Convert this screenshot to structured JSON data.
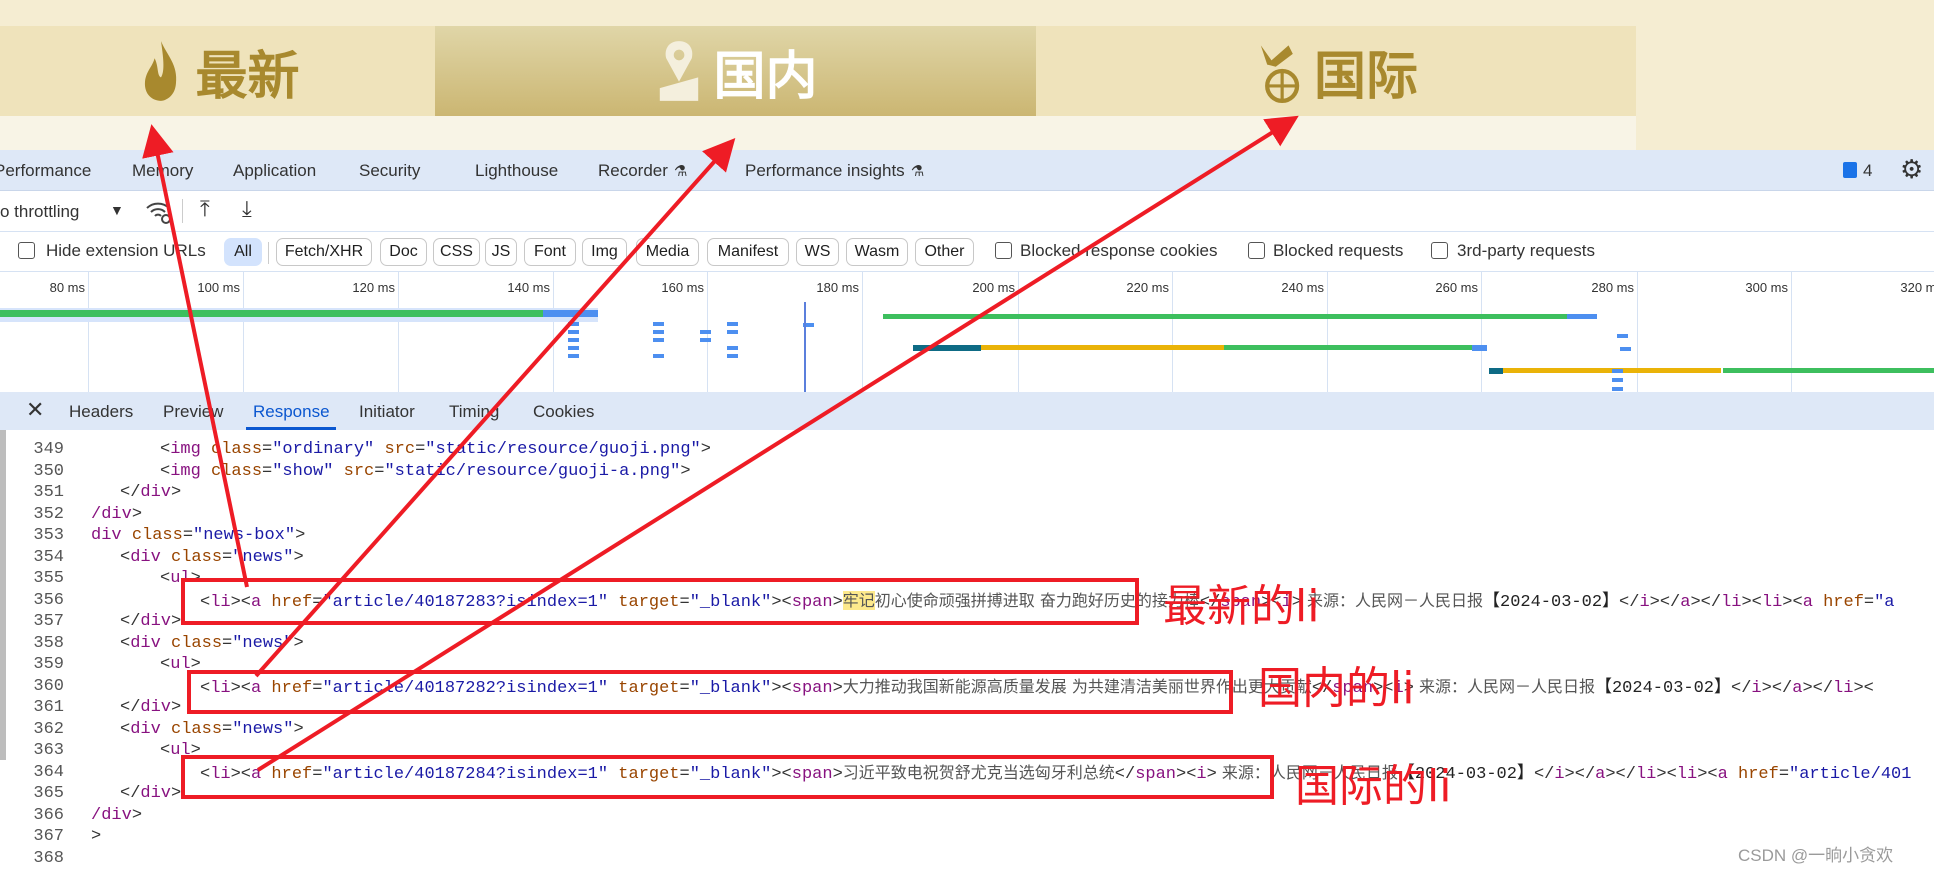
{
  "banner": {
    "tabs": [
      {
        "label": "最新",
        "icon": "flame-icon",
        "active": false
      },
      {
        "label": "国内",
        "icon": "map-pin-icon",
        "active": true
      },
      {
        "label": "国际",
        "icon": "globe-plane-icon",
        "active": false
      }
    ],
    "colors": {
      "tab_bg": "#efe3bb",
      "active_top": "#e0d6a8",
      "active_bottom": "#cbb672",
      "text": "#a8892e"
    }
  },
  "devtools": {
    "tabs": [
      "Performance",
      "Memory",
      "Application",
      "Security",
      "Lighthouse",
      "Recorder",
      "Performance insights"
    ],
    "issues_count": "4",
    "throttling": "o throttling",
    "filters": {
      "hide_ext": "Hide extension URLs",
      "chips": [
        "All",
        "Fetch/XHR",
        "Doc",
        "CSS",
        "JS",
        "Font",
        "Img",
        "Media",
        "Manifest",
        "WS",
        "Wasm",
        "Other"
      ],
      "checks": [
        "Blocked response cookies",
        "Blocked requests",
        "3rd-party requests"
      ]
    },
    "timeline_ticks": [
      "80 ms",
      "100 ms",
      "120 ms",
      "140 ms",
      "160 ms",
      "180 ms",
      "200 ms",
      "220 ms",
      "240 ms",
      "260 ms",
      "280 ms",
      "300 ms",
      "320 ms"
    ],
    "detail_tabs": [
      "Headers",
      "Preview",
      "Response",
      "Initiator",
      "Timing",
      "Cookies"
    ],
    "selected_detail_tab": "Response"
  },
  "code": [
    {
      "n": "349",
      "i": 2,
      "t": [
        [
          "br",
          "<"
        ],
        [
          "tag",
          "img"
        ],
        [
          "br",
          " "
        ],
        [
          "attr",
          "class"
        ],
        [
          "br",
          "="
        ],
        [
          "val",
          "\"ordinary\""
        ],
        [
          "br",
          " "
        ],
        [
          "attr",
          "src"
        ],
        [
          "br",
          "="
        ],
        [
          "val",
          "\"static/resource/guoji.png\""
        ],
        [
          "br",
          ">"
        ]
      ]
    },
    {
      "n": "350",
      "i": 2,
      "t": [
        [
          "br",
          "<"
        ],
        [
          "tag",
          "img"
        ],
        [
          "br",
          " "
        ],
        [
          "attr",
          "class"
        ],
        [
          "br",
          "="
        ],
        [
          "val",
          "\"show\""
        ],
        [
          "br",
          " "
        ],
        [
          "attr",
          "src"
        ],
        [
          "br",
          "="
        ],
        [
          "val",
          "\"static/resource/guoji-a.png\""
        ],
        [
          "br",
          ">"
        ]
      ]
    },
    {
      "n": "351",
      "i": 1,
      "t": [
        [
          "br",
          "</"
        ],
        [
          "tag",
          "div"
        ],
        [
          "br",
          ">"
        ]
      ]
    },
    {
      "n": "352",
      "i": 0,
      "t": [
        [
          "tag",
          "/div"
        ],
        [
          "br",
          ">"
        ]
      ]
    },
    {
      "n": "353",
      "i": 0,
      "t": [
        [
          "tag",
          "div"
        ],
        [
          "br",
          " "
        ],
        [
          "attr",
          "class"
        ],
        [
          "br",
          "="
        ],
        [
          "val",
          "\"news-box\""
        ],
        [
          "br",
          ">"
        ]
      ]
    },
    {
      "n": "354",
      "i": 1,
      "t": [
        [
          "br",
          "<"
        ],
        [
          "tag",
          "div"
        ],
        [
          "br",
          " "
        ],
        [
          "attr",
          "class"
        ],
        [
          "br",
          "="
        ],
        [
          "val",
          "\"news\""
        ],
        [
          "br",
          ">"
        ]
      ]
    },
    {
      "n": "355",
      "i": 2,
      "t": [
        [
          "br",
          "<"
        ],
        [
          "tag",
          "ul"
        ],
        [
          "br",
          ">"
        ]
      ]
    },
    {
      "n": "356",
      "i": 3,
      "t": [
        [
          "br",
          "<"
        ],
        [
          "tag",
          "li"
        ],
        [
          "br",
          "><"
        ],
        [
          "tag",
          "a"
        ],
        [
          "br",
          " "
        ],
        [
          "attr",
          "href"
        ],
        [
          "br",
          "="
        ],
        [
          "val",
          "\"article/40187283?isindex=1\""
        ],
        [
          "br",
          " "
        ],
        [
          "attr",
          "target"
        ],
        [
          "br",
          "="
        ],
        [
          "val",
          "\"_blank\""
        ],
        [
          "br",
          "><"
        ],
        [
          "tag",
          "span"
        ],
        [
          "br",
          ">"
        ],
        [
          "hl",
          "牢记"
        ],
        [
          "txt",
          "初心使命顽强拼搏进取 奋力跑好历史的接力棒"
        ],
        [
          "br",
          "</"
        ],
        [
          "tag",
          "span"
        ],
        [
          "br",
          "><"
        ],
        [
          "tag",
          "i"
        ],
        [
          "br",
          ">"
        ],
        [
          "txt",
          " 来源：人民网－人民日报"
        ],
        [
          "dark",
          "【2024-03-02】"
        ],
        [
          "br",
          "</"
        ],
        [
          "tag",
          "i"
        ],
        [
          "br",
          "></"
        ],
        [
          "tag",
          "a"
        ],
        [
          "br",
          "></"
        ],
        [
          "tag",
          "li"
        ],
        [
          "br",
          "><"
        ],
        [
          "tag",
          "li"
        ],
        [
          "br",
          "><"
        ],
        [
          "tag",
          "a"
        ],
        [
          "br",
          " "
        ],
        [
          "attr",
          "href"
        ],
        [
          "br",
          "="
        ],
        [
          "val",
          "\"a"
        ]
      ]
    },
    {
      "n": "357",
      "i": 1,
      "t": [
        [
          "br",
          "</"
        ],
        [
          "tag",
          "div"
        ],
        [
          "br",
          ">"
        ]
      ]
    },
    {
      "n": "358",
      "i": 1,
      "t": [
        [
          "br",
          "<"
        ],
        [
          "tag",
          "div"
        ],
        [
          "br",
          " "
        ],
        [
          "attr",
          "class"
        ],
        [
          "br",
          "="
        ],
        [
          "val",
          "\"news\""
        ],
        [
          "br",
          ">"
        ]
      ]
    },
    {
      "n": "359",
      "i": 2,
      "t": [
        [
          "br",
          "<"
        ],
        [
          "tag",
          "ul"
        ],
        [
          "br",
          ">"
        ]
      ]
    },
    {
      "n": "360",
      "i": 3,
      "t": [
        [
          "br",
          "<"
        ],
        [
          "tag",
          "li"
        ],
        [
          "br",
          "><"
        ],
        [
          "tag",
          "a"
        ],
        [
          "br",
          " "
        ],
        [
          "attr",
          "href"
        ],
        [
          "br",
          "="
        ],
        [
          "val",
          "\"article/40187282?isindex=1\""
        ],
        [
          "br",
          " "
        ],
        [
          "attr",
          "target"
        ],
        [
          "br",
          "="
        ],
        [
          "val",
          "\"_blank\""
        ],
        [
          "br",
          "><"
        ],
        [
          "tag",
          "span"
        ],
        [
          "br",
          ">"
        ],
        [
          "txt",
          "大力推动我国新能源高质量发展 为共建清洁美丽世界作出更大贡献"
        ],
        [
          "br",
          "</"
        ],
        [
          "tag",
          "span"
        ],
        [
          "br",
          "><"
        ],
        [
          "tag",
          "i"
        ],
        [
          "br",
          ">"
        ],
        [
          "txt",
          " 来源：人民网－人民日报"
        ],
        [
          "dark",
          "【2024-03-02】"
        ],
        [
          "br",
          "</"
        ],
        [
          "tag",
          "i"
        ],
        [
          "br",
          "></"
        ],
        [
          "tag",
          "a"
        ],
        [
          "br",
          "></"
        ],
        [
          "tag",
          "li"
        ],
        [
          "br",
          "><"
        ]
      ]
    },
    {
      "n": "361",
      "i": 1,
      "t": [
        [
          "br",
          "</"
        ],
        [
          "tag",
          "div"
        ],
        [
          "br",
          ">"
        ]
      ]
    },
    {
      "n": "362",
      "i": 1,
      "t": [
        [
          "br",
          "<"
        ],
        [
          "tag",
          "div"
        ],
        [
          "br",
          " "
        ],
        [
          "attr",
          "class"
        ],
        [
          "br",
          "="
        ],
        [
          "val",
          "\"news\""
        ],
        [
          "br",
          ">"
        ]
      ]
    },
    {
      "n": "363",
      "i": 2,
      "t": [
        [
          "br",
          "<"
        ],
        [
          "tag",
          "ul"
        ],
        [
          "br",
          ">"
        ]
      ]
    },
    {
      "n": "364",
      "i": 3,
      "t": [
        [
          "br",
          "<"
        ],
        [
          "tag",
          "li"
        ],
        [
          "br",
          "><"
        ],
        [
          "tag",
          "a"
        ],
        [
          "br",
          " "
        ],
        [
          "attr",
          "href"
        ],
        [
          "br",
          "="
        ],
        [
          "val",
          "\"article/40187284?isindex=1\""
        ],
        [
          "br",
          " "
        ],
        [
          "attr",
          "target"
        ],
        [
          "br",
          "="
        ],
        [
          "val",
          "\"_blank\""
        ],
        [
          "br",
          "><"
        ],
        [
          "tag",
          "span"
        ],
        [
          "br",
          ">"
        ],
        [
          "txt",
          "习近平致电祝贺舒尤克当选匈牙利总统"
        ],
        [
          "br",
          "</"
        ],
        [
          "tag",
          "span"
        ],
        [
          "br",
          "><"
        ],
        [
          "tag",
          "i"
        ],
        [
          "br",
          ">"
        ],
        [
          "txt",
          " 来源：人民网－人民日报"
        ],
        [
          "dark",
          "【2024-03-02】"
        ],
        [
          "br",
          "</"
        ],
        [
          "tag",
          "i"
        ],
        [
          "br",
          "></"
        ],
        [
          "tag",
          "a"
        ],
        [
          "br",
          "></"
        ],
        [
          "tag",
          "li"
        ],
        [
          "br",
          "><"
        ],
        [
          "tag",
          "li"
        ],
        [
          "br",
          "><"
        ],
        [
          "tag",
          "a"
        ],
        [
          "br",
          " "
        ],
        [
          "attr",
          "href"
        ],
        [
          "br",
          "="
        ],
        [
          "val",
          "\"article/401"
        ]
      ]
    },
    {
      "n": "365",
      "i": 1,
      "t": [
        [
          "br",
          "</"
        ],
        [
          "tag",
          "div"
        ],
        [
          "br",
          ">"
        ]
      ]
    },
    {
      "n": "366",
      "i": 0,
      "t": [
        [
          "tag",
          "/div"
        ],
        [
          "br",
          ">"
        ]
      ]
    },
    {
      "n": "367",
      "i": 0,
      "t": [
        [
          "br",
          ">"
        ]
      ]
    },
    {
      "n": "368",
      "i": 0,
      "t": []
    }
  ],
  "annotations": {
    "latest": "最新的li",
    "domestic": "国内的li",
    "international": "国际的li",
    "color": "#ee1c25"
  },
  "watermark": "CSDN @一晌小贪欢"
}
